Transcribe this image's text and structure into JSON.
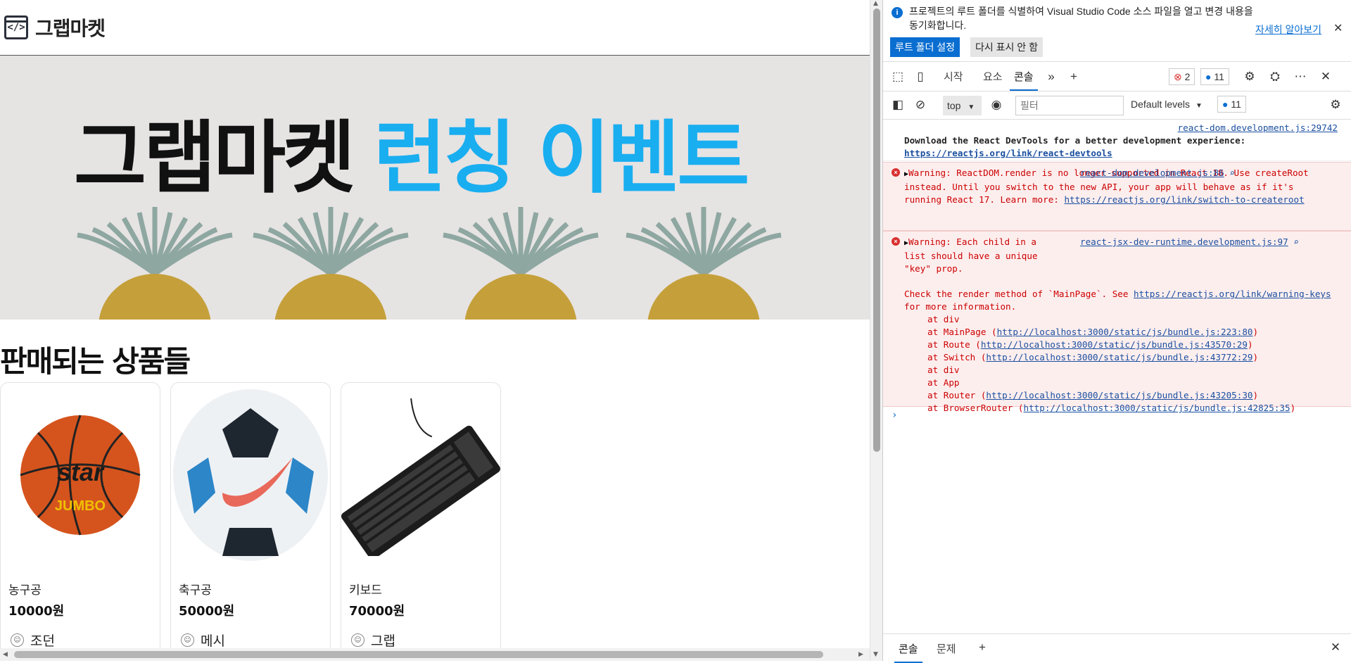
{
  "app": {
    "logo_symbol": "</>",
    "logo_text": "그랩마켓",
    "banner_title_1": "그랩마켓",
    "banner_title_2": "런칭 이벤트",
    "section_title": "판매되는 상품들",
    "products": [
      {
        "name": "농구공",
        "price": "10000원",
        "seller": "조던",
        "image": "basketball"
      },
      {
        "name": "축구공",
        "price": "50000원",
        "seller": "메시",
        "image": "soccer-ball"
      },
      {
        "name": "키보드",
        "price": "70000원",
        "seller": "그랩",
        "image": "keyboard"
      }
    ]
  },
  "devtools": {
    "infobar": {
      "message": "프로젝트의 루트 폴더를 식별하여 Visual Studio Code 소스 파일을 열고 변경 내용을 동기화합니다.",
      "learn_more": "자세히 알아보기",
      "set_root_button": "루트 폴더 설정",
      "dont_show_button": "다시 표시 안 함"
    },
    "tabs": [
      "시작",
      "요소",
      "콘솔"
    ],
    "active_tab": "콘솔",
    "error_count": "2",
    "message_count": "11",
    "toolbar": {
      "context": "top",
      "filter_placeholder": "필터",
      "levels": "Default levels",
      "issue_count": "11"
    },
    "console": {
      "msg1": {
        "source": "react-dom.development.js:29742",
        "text": "Download the React DevTools for a better development experience: ",
        "link": "https://reactjs.org/link/react-devtools"
      },
      "err1": {
        "source": "react-dom.development.js:86",
        "text": "Warning: ReactDOM.render is no longer supported in React 18. Use createRoot instead. Until you switch to the new API, your app will behave as if it's running React 17. Learn more: ",
        "link": "https://reactjs.org/link/switch-to-createroot"
      },
      "err2": {
        "source": "react-jsx-dev-runtime.development.js:97",
        "text": "Warning: Each child in a list should have a unique \"key\" prop.",
        "text2": "Check the render method of `MainPage`. See ",
        "link": "https://reactjs.org/link/warning-keys",
        "text3": " for more information.",
        "stack": [
          {
            "at": "at div",
            "link": ""
          },
          {
            "at": "at MainPage (",
            "link": "http://localhost:3000/static/js/bundle.js:223:80"
          },
          {
            "at": "at Route (",
            "link": "http://localhost:3000/static/js/bundle.js:43570:29"
          },
          {
            "at": "at Switch (",
            "link": "http://localhost:3000/static/js/bundle.js:43772:29"
          },
          {
            "at": "at div",
            "link": ""
          },
          {
            "at": "at App",
            "link": ""
          },
          {
            "at": "at Router (",
            "link": "http://localhost:3000/static/js/bundle.js:43205:30"
          },
          {
            "at": "at BrowserRouter (",
            "link": "http://localhost:3000/static/js/bundle.js:42825:35"
          }
        ]
      }
    },
    "drawer_tabs": [
      "콘솔",
      "문제"
    ]
  }
}
